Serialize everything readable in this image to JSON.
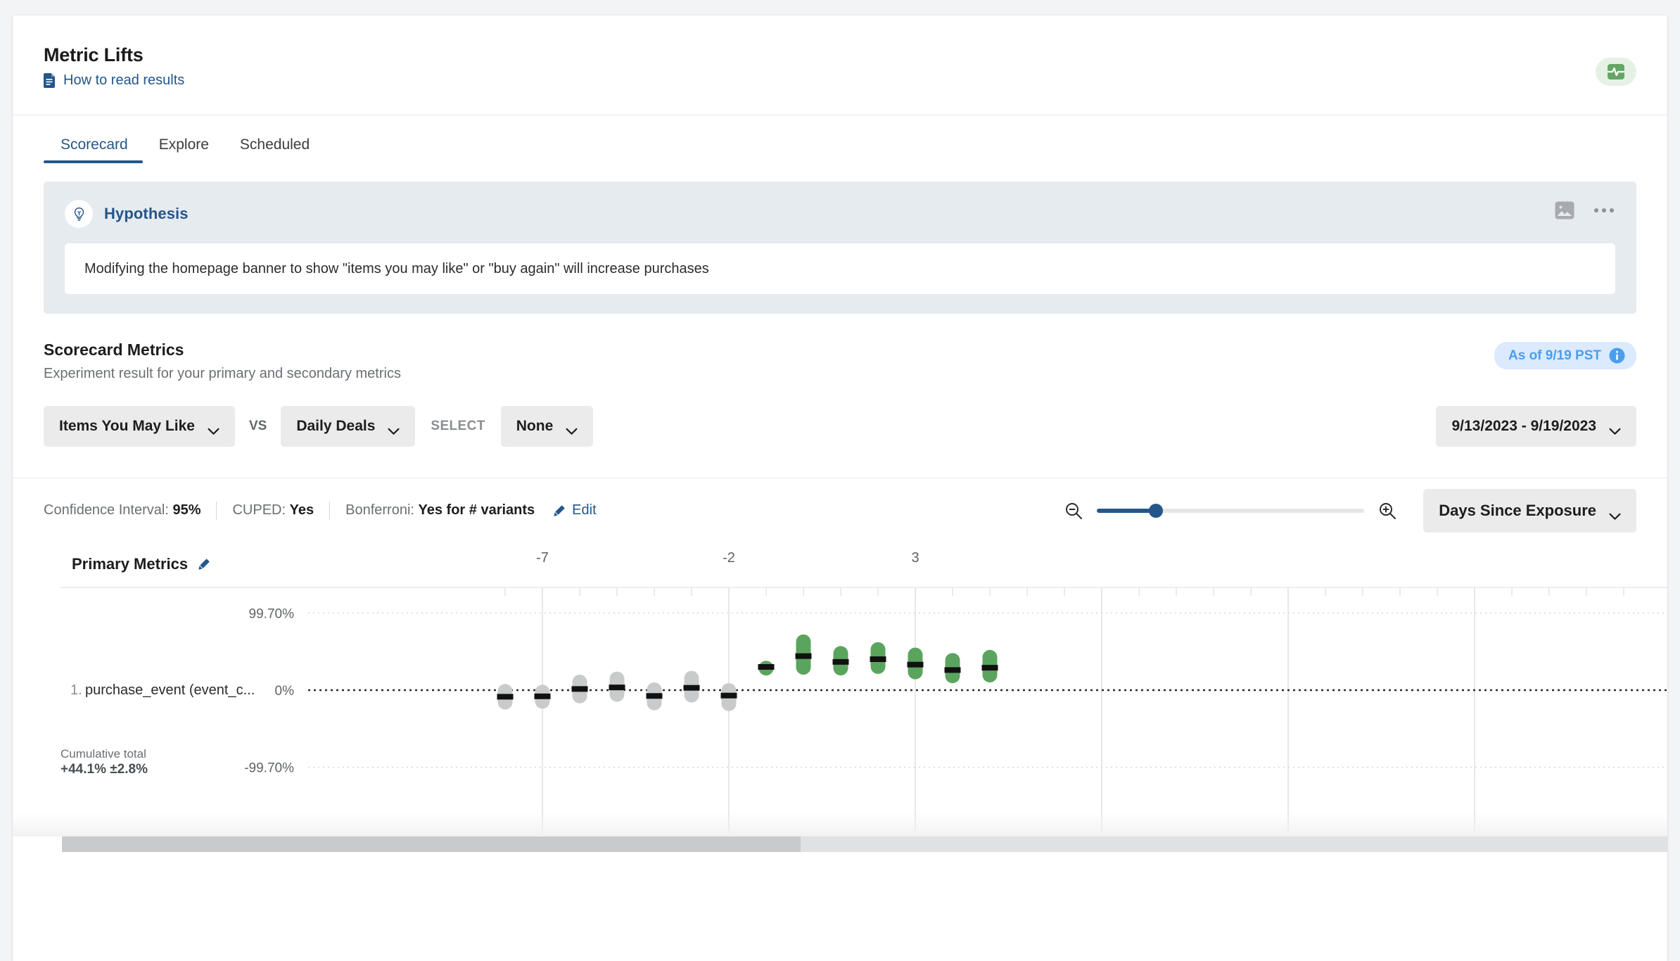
{
  "header": {
    "title": "Metric Lifts",
    "howto_link": "How to read results",
    "doc_icon": "document-icon",
    "health_icon": "pulse-monitor-icon"
  },
  "tabs": [
    {
      "label": "Scorecard",
      "active": true
    },
    {
      "label": "Explore",
      "active": false
    },
    {
      "label": "Scheduled",
      "active": false
    }
  ],
  "hypothesis": {
    "title": "Hypothesis",
    "bulb_icon": "lightbulb-icon",
    "image_icon": "image-icon",
    "more_icon": "ellipsis-icon",
    "text": "Modifying the homepage banner to show \"items you may like\" or \"buy again\" will increase purchases"
  },
  "scorecard": {
    "title": "Scorecard Metrics",
    "subtitle": "Experiment result for your primary and secondary metrics",
    "as_of": "As of 9/19 PST",
    "info_icon": "info-icon",
    "variant_a": "Items You May Like",
    "vs": "VS",
    "variant_b": "Daily Deals",
    "select_label": "SELECT",
    "segment": "None",
    "date_range": "9/13/2023 - 9/19/2023"
  },
  "stats": {
    "ci_label": "Confidence Interval:",
    "ci_value": "95%",
    "cuped_label": "CUPED:",
    "cuped_value": "Yes",
    "bonferroni_label": "Bonferroni:",
    "bonferroni_value": "Yes for # variants",
    "edit_label": "Edit",
    "edit_icon": "pencil-icon",
    "zoom_out_icon": "zoom-out-icon",
    "zoom_in_icon": "zoom-in-icon",
    "zoom_value": 22,
    "exposure_dropdown": "Days Since Exposure"
  },
  "chart_section": {
    "primary_metrics_label": "Primary Metrics",
    "edit_icon": "pencil-icon",
    "metric_index": "1.",
    "metric_name": "purchase_event (event_c...",
    "cumulative_label": "Cumulative total",
    "cumulative_value": "+44.1% ±2.8%"
  },
  "colors": {
    "accent_blue": "#24568a",
    "green_bar": "#5ba45e",
    "gray_bar": "#c9cacb",
    "hypothesis_bg": "#e6ebef",
    "chip_bg": "#ebebeb",
    "asof_bg": "#dbeafe",
    "asof_text": "#4a9ef0"
  },
  "chart_data": {
    "type": "bar",
    "title": "Primary Metrics — purchase_event (event_c...",
    "xlabel": "Days Since Exposure",
    "ylabel": "",
    "x_ticks": [
      -7,
      -2,
      3
    ],
    "y_ticks": [
      "99.70%",
      "0%",
      "-99.70%"
    ],
    "ylim": [
      -99.7,
      99.7
    ],
    "grid": true,
    "legend": "none",
    "zero_line": 0,
    "series": [
      {
        "name": "Confidence intervals (lift % per day since exposure)",
        "points": [
          {
            "x": -8,
            "mean": -8.5,
            "low": -25.0,
            "high": 8.0,
            "significant": false,
            "color": "#c9cacb"
          },
          {
            "x": -7,
            "mean": -8.0,
            "low": -24.0,
            "high": 7.0,
            "significant": false,
            "color": "#c9cacb"
          },
          {
            "x": -6,
            "mean": 1.5,
            "low": -17.0,
            "high": 20.0,
            "significant": false,
            "color": "#c9cacb"
          },
          {
            "x": -5,
            "mean": 3.5,
            "low": -15.0,
            "high": 24.0,
            "significant": false,
            "color": "#c9cacb"
          },
          {
            "x": -4,
            "mean": -7.5,
            "low": -26.0,
            "high": 10.0,
            "significant": false,
            "color": "#c9cacb"
          },
          {
            "x": -3,
            "mean": 3.0,
            "low": -16.0,
            "high": 25.0,
            "significant": false,
            "color": "#c9cacb"
          },
          {
            "x": -2,
            "mean": -7.0,
            "low": -27.0,
            "high": 9.0,
            "significant": false,
            "color": "#c9cacb"
          },
          {
            "x": -1,
            "mean": 30.0,
            "low": 23.0,
            "high": 38.0,
            "significant": true,
            "color": "#5ba45e"
          },
          {
            "x": 0,
            "mean": 44.0,
            "low": 20.0,
            "high": 72.0,
            "significant": true,
            "color": "#5ba45e"
          },
          {
            "x": 1,
            "mean": 36.5,
            "low": 19.0,
            "high": 57.0,
            "significant": true,
            "color": "#5ba45e"
          },
          {
            "x": 2,
            "mean": 40.0,
            "low": 21.0,
            "high": 62.0,
            "significant": true,
            "color": "#5ba45e"
          },
          {
            "x": 3,
            "mean": 33.0,
            "low": 14.0,
            "high": 55.0,
            "significant": true,
            "color": "#5ba45e"
          },
          {
            "x": 4,
            "mean": 26.0,
            "low": 9.0,
            "high": 48.0,
            "significant": true,
            "color": "#5ba45e"
          },
          {
            "x": 5,
            "mean": 29.0,
            "low": 10.0,
            "high": 52.0,
            "significant": true,
            "color": "#5ba45e"
          }
        ]
      }
    ],
    "cumulative_total": "+44.1% ±2.8%"
  }
}
